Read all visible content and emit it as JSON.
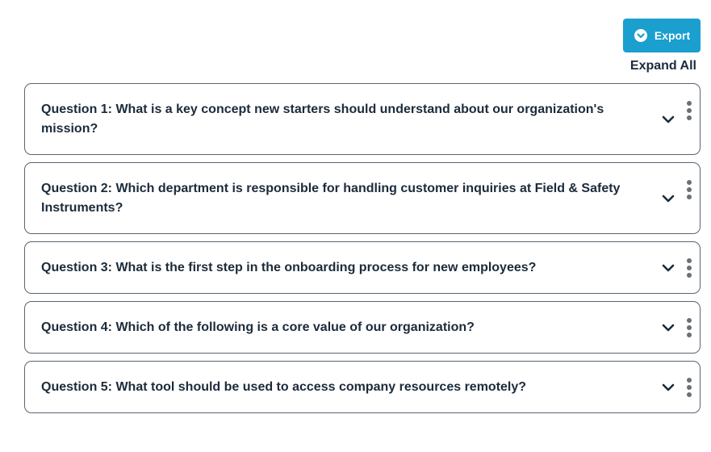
{
  "toolbar": {
    "export_label": "Export",
    "export_icon": "chevron-down-circle-icon",
    "expand_all_label": "Expand All",
    "accent_color": "#1a9fcf"
  },
  "questions": [
    {
      "text": "Question 1: What is a key concept new starters should understand about our organization's mission?"
    },
    {
      "text": "Question 2: Which department is responsible for handling customer inquiries at Field & Safety Instruments?"
    },
    {
      "text": "Question 3: What is the first step in the onboarding process for new employees?"
    },
    {
      "text": "Question 4: Which of the following is a core value of our organization?"
    },
    {
      "text": "Question 5: What tool should be used to access company resources remotely?"
    }
  ]
}
